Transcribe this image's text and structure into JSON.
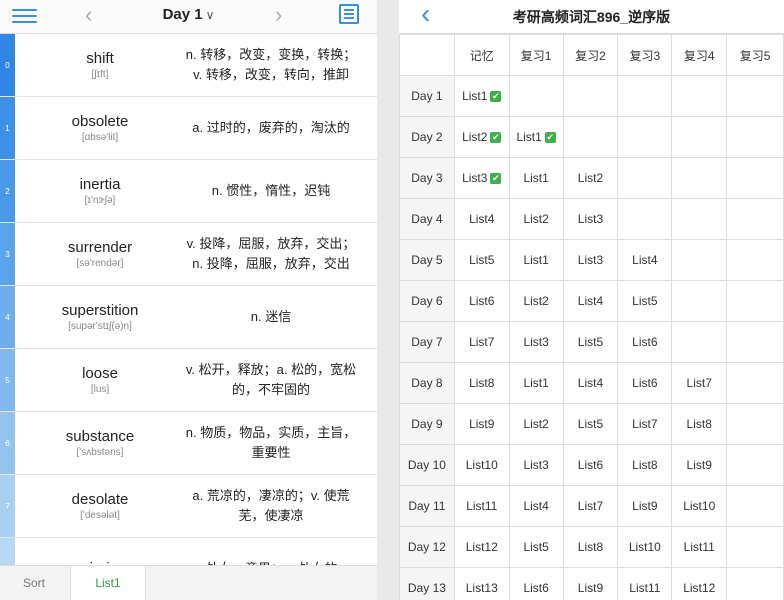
{
  "left": {
    "title": "Day 1",
    "words": [
      {
        "idx": "0",
        "word": "shift",
        "phon": "[ʃɪft]",
        "def": "n. 转移，改变，变换，转换；v. 转移，改变，转向，推卸"
      },
      {
        "idx": "1",
        "word": "obsolete",
        "phon": "[ɑbsə'lit]",
        "def": "a. 过时的，废弃的，淘汰的"
      },
      {
        "idx": "2",
        "word": "inertia",
        "phon": "[ɪ'nɝʃə]",
        "def": "n. 惯性，惰性，迟钝"
      },
      {
        "idx": "3",
        "word": "surrender",
        "phon": "[sə'rendər]",
        "def": "v. 投降，屈服，放弃，交出；n. 投降，屈服，放弃，交出"
      },
      {
        "idx": "4",
        "word": "superstition",
        "phon": "[supər'stɪʃ(ə)n]",
        "def": "n. 迷信"
      },
      {
        "idx": "5",
        "word": "loose",
        "phon": "[lus]",
        "def": "v. 松开，释放；a. 松的，宽松的，不牢固的"
      },
      {
        "idx": "6",
        "word": "substance",
        "phon": "['sʌbstəns]",
        "def": "n. 物质，物品，实质，主旨，重要性"
      },
      {
        "idx": "7",
        "word": "desolate",
        "phon": "['desələt]",
        "def": "a. 荒凉的，凄凉的；v. 使荒芜，使凄凉"
      },
      {
        "idx": "8",
        "word": "virgin",
        "phon": "",
        "def": "n. 处女，童男；a. 处女的，"
      }
    ],
    "tabs": [
      "Sort",
      "List1"
    ]
  },
  "right": {
    "title": "考研高频词汇896_逆序版",
    "headers": [
      "",
      "记忆",
      "复习1",
      "复习2",
      "复习3",
      "复习4",
      "复习5"
    ],
    "rows": [
      [
        "Day 1",
        "List1",
        "",
        "",
        "",
        "",
        ""
      ],
      [
        "Day 2",
        "List2",
        "List1",
        "",
        "",
        "",
        ""
      ],
      [
        "Day 3",
        "List3",
        "List1",
        "List2",
        "",
        "",
        ""
      ],
      [
        "Day 4",
        "List4",
        "List2",
        "List3",
        "",
        "",
        ""
      ],
      [
        "Day 5",
        "List5",
        "List1",
        "List3",
        "List4",
        "",
        ""
      ],
      [
        "Day 6",
        "List6",
        "List2",
        "List4",
        "List5",
        "",
        ""
      ],
      [
        "Day 7",
        "List7",
        "List3",
        "List5",
        "List6",
        "",
        ""
      ],
      [
        "Day 8",
        "List8",
        "List1",
        "List4",
        "List6",
        "List7",
        ""
      ],
      [
        "Day 9",
        "List9",
        "List2",
        "List5",
        "List7",
        "List8",
        ""
      ],
      [
        "Day 10",
        "List10",
        "List3",
        "List6",
        "List8",
        "List9",
        ""
      ],
      [
        "Day 11",
        "List11",
        "List4",
        "List7",
        "List9",
        "List10",
        ""
      ],
      [
        "Day 12",
        "List12",
        "List5",
        "List8",
        "List10",
        "List11",
        ""
      ],
      [
        "Day 13",
        "List13",
        "List6",
        "List9",
        "List11",
        "List12",
        ""
      ]
    ],
    "checked": [
      "0-1",
      "1-1",
      "1-2",
      "2-1"
    ]
  },
  "colors": {
    "accent": "#3a8ee6",
    "check": "#3cb04a",
    "active_tab": "#2e9d3a",
    "index_strip": [
      "#2f87e3",
      "#3c90e6",
      "#4a99e8",
      "#5ba3ea",
      "#6eaeec",
      "#80b9ee",
      "#93c4f0",
      "#a6cff2",
      "#b8d9f4"
    ]
  }
}
